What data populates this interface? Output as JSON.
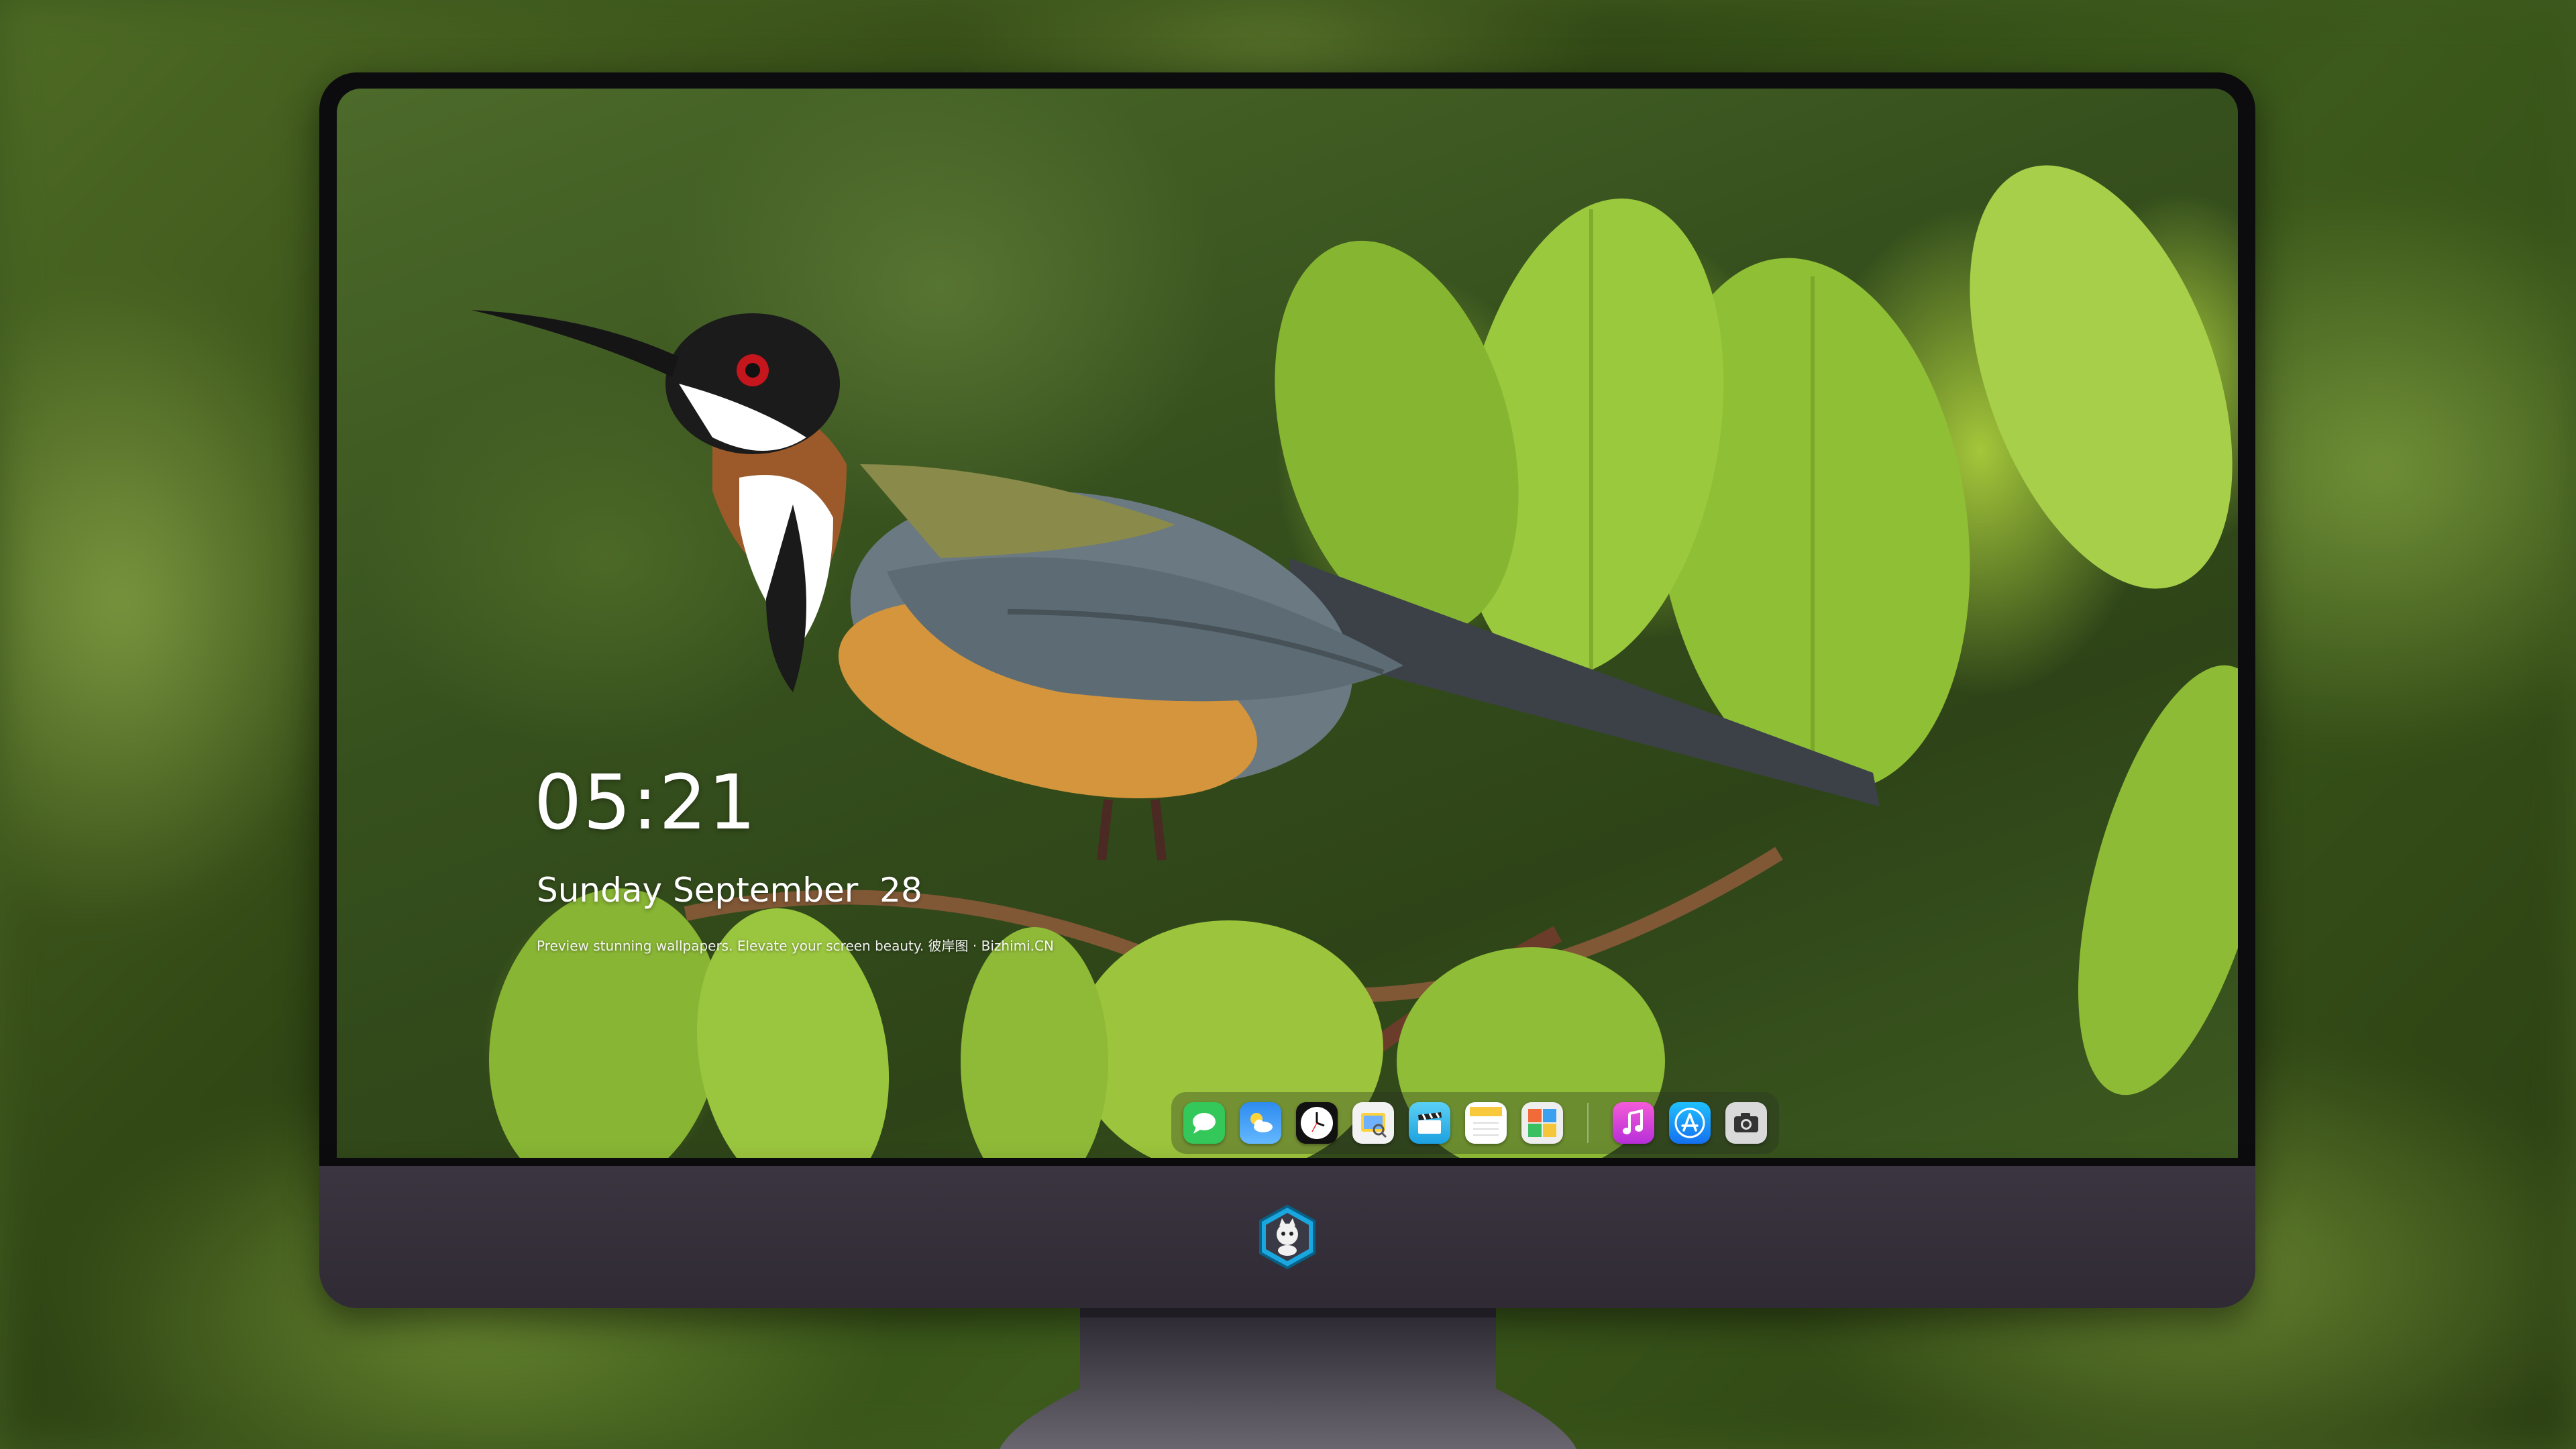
{
  "lockscreen": {
    "time": "05:21",
    "date": "Sunday September  28",
    "tagline": "Preview stunning wallpapers. Elevate your screen beauty. 彼岸图 · Bizhimi.CN"
  },
  "dock": {
    "apps": [
      {
        "name": "Messages",
        "icon": "message-bubble-icon"
      },
      {
        "name": "Weather",
        "icon": "weather-icon"
      },
      {
        "name": "Clock",
        "icon": "clock-icon"
      },
      {
        "name": "Preview",
        "icon": "preview-icon"
      },
      {
        "name": "Clips",
        "icon": "clapperboard-icon"
      },
      {
        "name": "Notes",
        "icon": "notes-icon"
      },
      {
        "name": "Photo Booth",
        "icon": "photo-booth-icon"
      },
      {
        "name": "Music",
        "icon": "music-note-icon"
      },
      {
        "name": "App Store",
        "icon": "app-store-icon"
      },
      {
        "name": "Camera",
        "icon": "camera-icon"
      }
    ]
  },
  "colors": {
    "bezel": "#0c0c0e",
    "chin": "#3a3540",
    "leaf_green": "#9cc43c",
    "music": "#e63fd0",
    "appstore": "#1e90ff",
    "messages": "#34c759"
  }
}
